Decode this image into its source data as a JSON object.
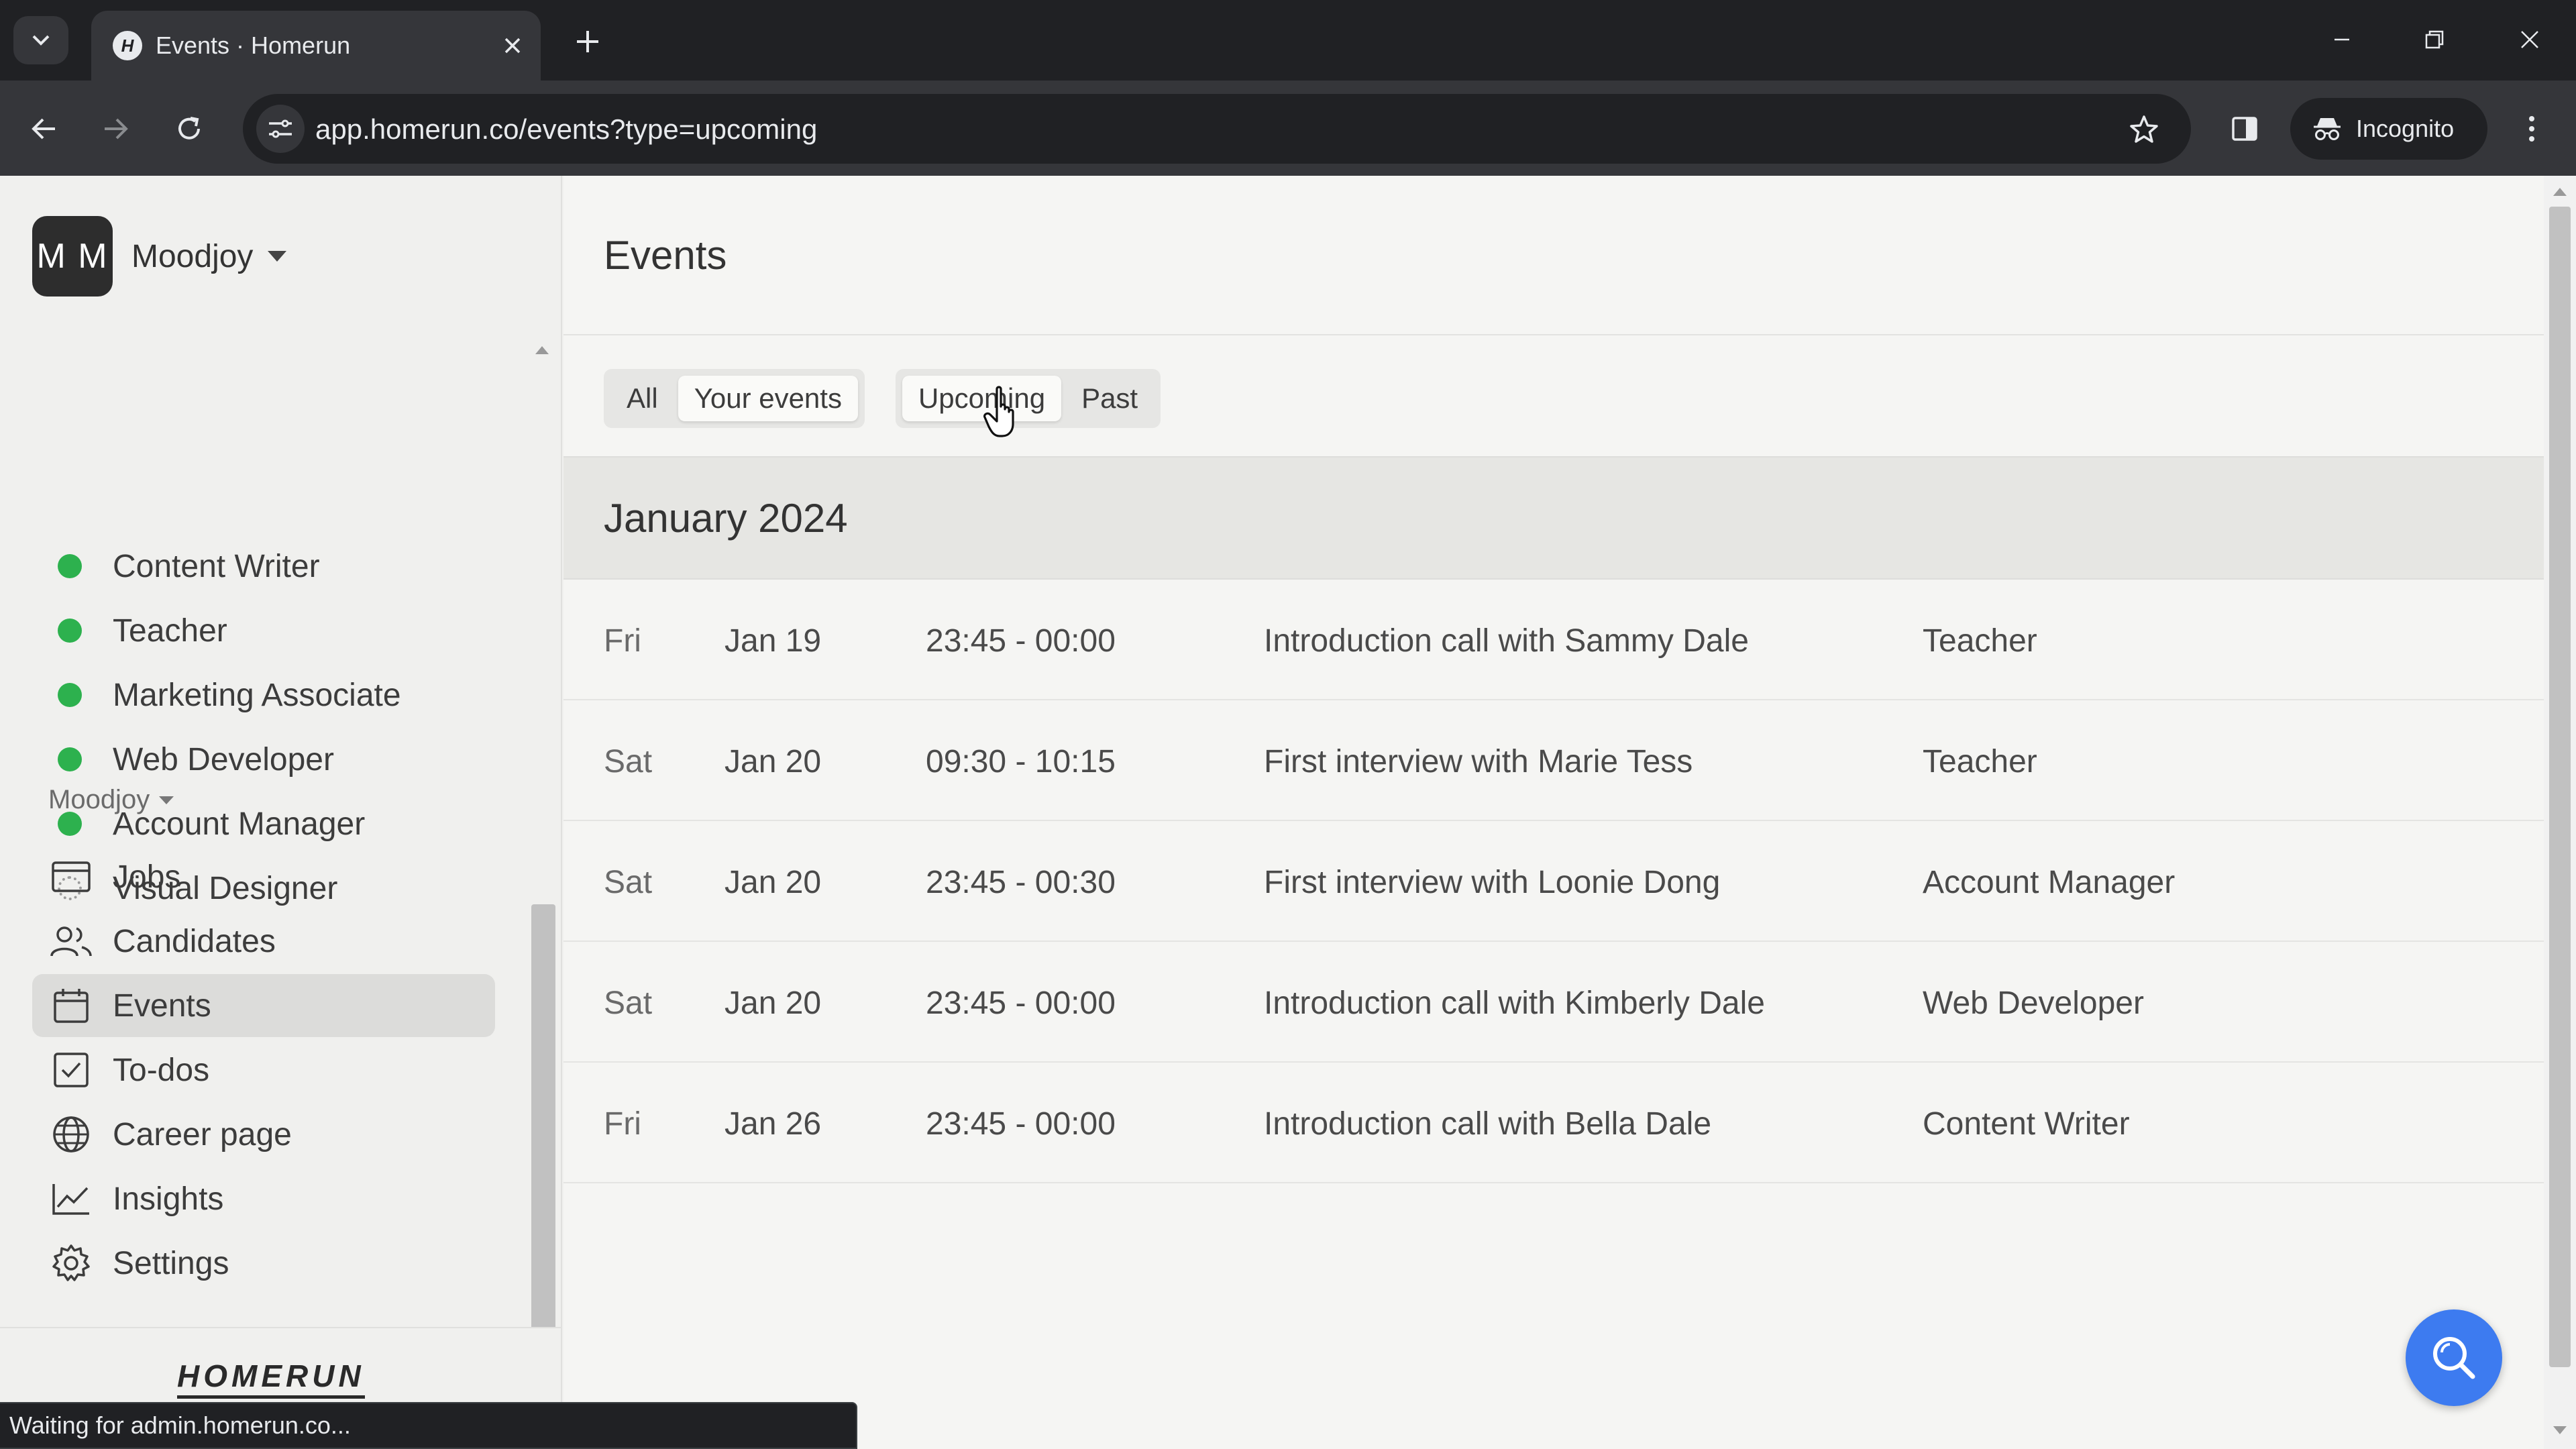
{
  "browser": {
    "tab_title": "Events · Homerun",
    "favicon_letter": "H",
    "url": "app.homerun.co/events?type=upcoming",
    "incognito_label": "Incognito",
    "status_text": "Waiting for admin.homerun.co..."
  },
  "sidebar": {
    "org_initials": "M M",
    "org_name": "Moodjoy",
    "jobs": [
      {
        "label": "Content Writer",
        "status": "active"
      },
      {
        "label": "Teacher",
        "status": "active"
      },
      {
        "label": "Marketing Associate",
        "status": "active"
      },
      {
        "label": "Web Developer",
        "status": "active"
      },
      {
        "label": "Account Manager",
        "status": "active"
      },
      {
        "label": "Visual Designer",
        "status": "paused"
      }
    ],
    "section_label": "Moodjoy",
    "nav": [
      {
        "label": "Jobs",
        "icon": "briefcase-icon"
      },
      {
        "label": "Candidates",
        "icon": "users-icon"
      },
      {
        "label": "Events",
        "icon": "calendar-icon",
        "active": true
      },
      {
        "label": "To-dos",
        "icon": "checkbox-icon"
      },
      {
        "label": "Career page",
        "icon": "globe-icon"
      },
      {
        "label": "Insights",
        "icon": "chart-line-icon"
      },
      {
        "label": "Settings",
        "icon": "gear-icon"
      }
    ],
    "brand": "HOMERUN"
  },
  "main": {
    "title": "Events",
    "filters": {
      "scope": [
        "All",
        "Your events"
      ],
      "scope_selected": "Your events",
      "time": [
        "Upcoming",
        "Past"
      ],
      "time_selected": "Upcoming"
    },
    "month": "January 2024",
    "events": [
      {
        "day": "Fri",
        "date": "Jan 19",
        "time": "23:45 - 00:00",
        "title": "Introduction call with Sammy Dale",
        "job": "Teacher"
      },
      {
        "day": "Sat",
        "date": "Jan 20",
        "time": "09:30 - 10:15",
        "title": "First interview with Marie Tess",
        "job": "Teacher"
      },
      {
        "day": "Sat",
        "date": "Jan 20",
        "time": "23:45 - 00:30",
        "title": "First interview with Loonie Dong",
        "job": "Account Manager"
      },
      {
        "day": "Sat",
        "date": "Jan 20",
        "time": "23:45 - 00:00",
        "title": "Introduction call with Kimberly Dale",
        "job": "Web Developer"
      },
      {
        "day": "Fri",
        "date": "Jan 26",
        "time": "23:45 - 00:00",
        "title": "Introduction call with Bella Dale",
        "job": "Content Writer"
      }
    ]
  },
  "colors": {
    "active_dot": "#2db14e",
    "fab": "#3d7bf0",
    "chrome_dark": "#202124",
    "chrome_toolbar": "#35363a"
  }
}
